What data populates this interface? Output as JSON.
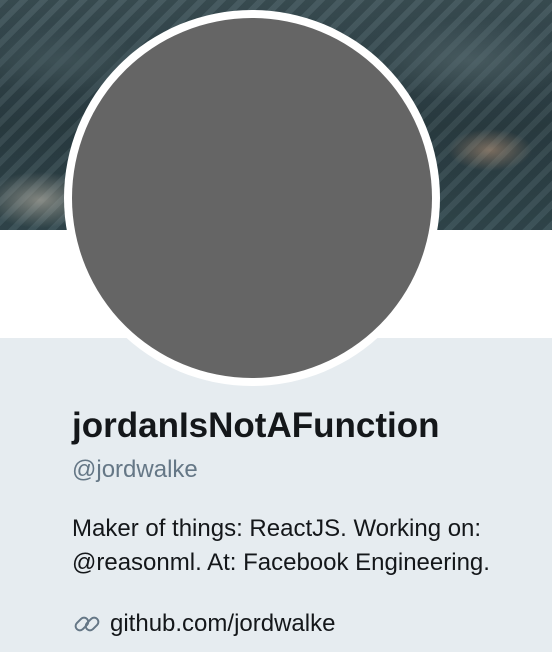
{
  "profile": {
    "display_name": "jordanIsNotAFunction",
    "handle": "@jordwalke",
    "bio_line_1": "Maker of things: ReactJS. Working on:",
    "bio_line_2": "@reasonml. At: Facebook Engineering.",
    "website": "github.com/jordwalke",
    "website_icon": "link-icon"
  },
  "colors": {
    "panel_background": "#e6ecf0",
    "avatar_placeholder": "#656565",
    "name_text": "#14171a",
    "handle_text": "#657786"
  }
}
